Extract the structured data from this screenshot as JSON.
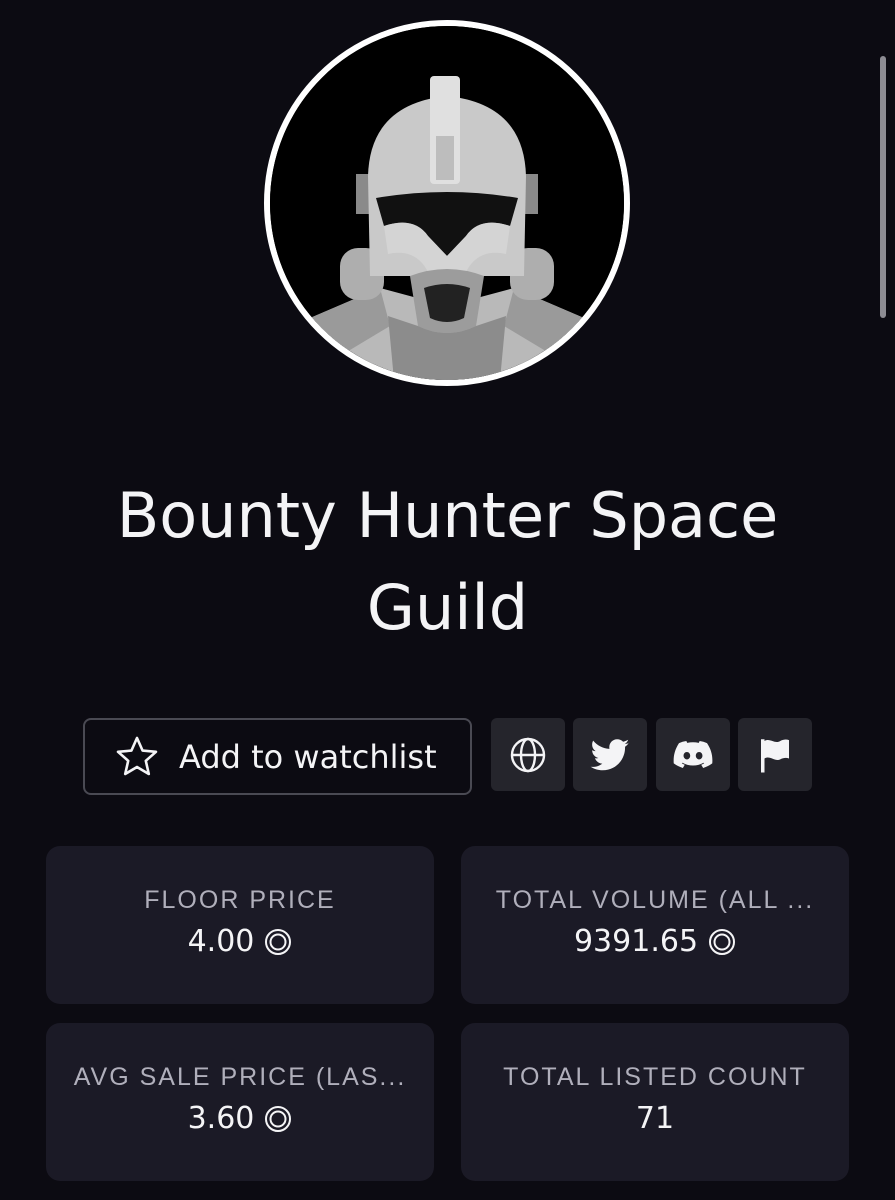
{
  "collection": {
    "title": "Bounty Hunter Space Guild",
    "avatar_icon": "trooper-helmet-avatar"
  },
  "actions": {
    "watchlist_label": "Add to watchlist",
    "watchlist_icon": "star-icon",
    "links": [
      {
        "name": "website",
        "icon": "globe-icon"
      },
      {
        "name": "twitter",
        "icon": "twitter-bird-icon"
      },
      {
        "name": "discord",
        "icon": "discord-icon"
      },
      {
        "name": "report",
        "icon": "flag-icon"
      }
    ]
  },
  "stats": [
    {
      "label": "FLOOR PRICE",
      "value": "4.00",
      "currency_icon": "coin-icon"
    },
    {
      "label": "TOTAL VOLUME (ALL ...",
      "value": "9391.65",
      "currency_icon": "coin-icon"
    },
    {
      "label": "AVG SALE PRICE (LAS...",
      "value": "3.60",
      "currency_icon": "coin-icon"
    },
    {
      "label": "TOTAL LISTED COUNT",
      "value": "71"
    }
  ],
  "colors": {
    "background": "#0c0b12",
    "card": "#1b1a26",
    "icon_button": "#25252c",
    "label": "#b0afbb",
    "text": "#f4f4f6"
  }
}
